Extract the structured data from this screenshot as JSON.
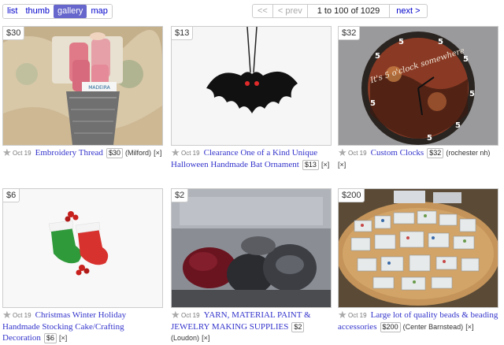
{
  "toolbar": {
    "views": [
      {
        "label": "list",
        "active": false
      },
      {
        "label": "thumb",
        "active": false
      },
      {
        "label": "gallery",
        "active": true
      },
      {
        "label": "map",
        "active": false
      }
    ],
    "pager": {
      "first": "<<",
      "prev": "< prev",
      "range": "1 to 100 of 1029",
      "next": "next >"
    }
  },
  "listings": [
    {
      "price_badge": "$30",
      "date": "Oct 19",
      "title": "Embroidery Thread",
      "price": "$30",
      "location": "(Milford)",
      "hide": "[×]"
    },
    {
      "price_badge": "$13",
      "date": "Oct 19",
      "title": "Clearance One of a Kind Unique Halloween Handmade Bat Ornament",
      "price": "$13",
      "location": "",
      "hide": "[×]"
    },
    {
      "price_badge": "$32",
      "date": "Oct 19",
      "title": "Custom Clocks",
      "price": "$32",
      "location": "(rochester nh)",
      "hide": "[×]"
    },
    {
      "price_badge": "$6",
      "date": "Oct 19",
      "title": "Christmas Winter Holiday Handmade Stocking Cake/Crafting Decoration",
      "price": "$6",
      "location": "",
      "hide": "[×]"
    },
    {
      "price_badge": "$2",
      "date": "Oct 19",
      "title": "YARN, MATERIAL PAINT & JEWELRY MAKING SUPPLIES",
      "price": "$2",
      "location": "(Loudon)",
      "hide": "[×]"
    },
    {
      "price_badge": "$200",
      "date": "Oct 19",
      "title": "Large lot of quality beads & beading accessories",
      "price": "$200",
      "location": "(Center Barnstead)",
      "hide": "[×]"
    }
  ],
  "clock_text": "It's 5 o'clock somewhere",
  "clock_numeral": "5",
  "spool_label": "MADEIRA",
  "colors": {
    "link": "#3333cc",
    "active_view": "#6666cc"
  }
}
